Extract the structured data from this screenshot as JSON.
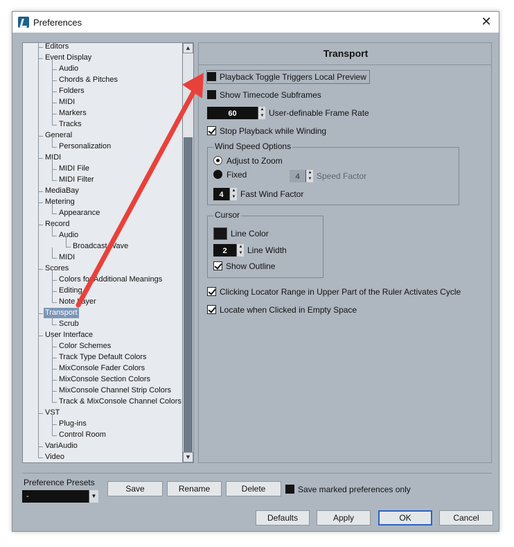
{
  "window": {
    "title": "Preferences",
    "close_glyph": "✕",
    "icon": "cubase-logo-icon"
  },
  "tree": {
    "items": [
      {
        "label": "Editors",
        "depth": 0
      },
      {
        "label": "Event Display",
        "depth": 0
      },
      {
        "label": "Audio",
        "depth": 1
      },
      {
        "label": "Chords & Pitches",
        "depth": 1
      },
      {
        "label": "Folders",
        "depth": 1
      },
      {
        "label": "MIDI",
        "depth": 1
      },
      {
        "label": "Markers",
        "depth": 1
      },
      {
        "label": "Tracks",
        "depth": 1
      },
      {
        "label": "General",
        "depth": 0
      },
      {
        "label": "Personalization",
        "depth": 1
      },
      {
        "label": "MIDI",
        "depth": 0
      },
      {
        "label": "MIDI File",
        "depth": 1
      },
      {
        "label": "MIDI Filter",
        "depth": 1
      },
      {
        "label": "MediaBay",
        "depth": 0
      },
      {
        "label": "Metering",
        "depth": 0
      },
      {
        "label": "Appearance",
        "depth": 1
      },
      {
        "label": "Record",
        "depth": 0
      },
      {
        "label": "Audio",
        "depth": 1
      },
      {
        "label": "Broadcast Wave",
        "depth": 2
      },
      {
        "label": "MIDI",
        "depth": 1
      },
      {
        "label": "Scores",
        "depth": 0
      },
      {
        "label": "Colors for Additional Meanings",
        "depth": 1
      },
      {
        "label": "Editing",
        "depth": 1
      },
      {
        "label": "Note Layer",
        "depth": 1
      },
      {
        "label": "Transport",
        "depth": 0,
        "selected": true
      },
      {
        "label": "Scrub",
        "depth": 1
      },
      {
        "label": "User Interface",
        "depth": 0
      },
      {
        "label": "Color Schemes",
        "depth": 1
      },
      {
        "label": "Track Type Default Colors",
        "depth": 1
      },
      {
        "label": "MixConsole Fader Colors",
        "depth": 1
      },
      {
        "label": "MixConsole Section Colors",
        "depth": 1
      },
      {
        "label": "MixConsole Channel Strip Colors",
        "depth": 1
      },
      {
        "label": "Track & MixConsole Channel Colors",
        "depth": 1
      },
      {
        "label": "VST",
        "depth": 0
      },
      {
        "label": "Plug-ins",
        "depth": 1
      },
      {
        "label": "Control Room",
        "depth": 1
      },
      {
        "label": "VariAudio",
        "depth": 0
      },
      {
        "label": "Video",
        "depth": 0
      }
    ],
    "scroll_up_glyph": "▲",
    "scroll_down_glyph": "▼"
  },
  "transport": {
    "title": "Transport",
    "playback_toggle_local_preview": {
      "label": "Playback Toggle Triggers Local Preview",
      "checked": false
    },
    "show_timecode_subframes": {
      "label": "Show Timecode Subframes",
      "checked": false
    },
    "frame_rate": {
      "value": "60",
      "label": "User-definable Frame Rate"
    },
    "stop_playback_winding": {
      "label": "Stop Playback while Winding",
      "checked": true
    },
    "wind_speed": {
      "group_label": "Wind Speed Options",
      "adjust_to_zoom": {
        "label": "Adjust to Zoom",
        "selected": true
      },
      "fixed": {
        "label": "Fixed",
        "selected": false
      },
      "speed_factor": {
        "value": "4",
        "label": "Speed Factor",
        "enabled": false
      },
      "fast_wind_factor": {
        "value": "4",
        "label": "Fast Wind Factor"
      }
    },
    "cursor": {
      "group_label": "Cursor",
      "line_color_label": "Line Color",
      "line_color": "#161616",
      "line_width": {
        "value": "2",
        "label": "Line Width"
      },
      "show_outline": {
        "label": "Show Outline",
        "checked": true
      }
    },
    "locator_range_cycle": {
      "label": "Clicking Locator Range in Upper Part of the Ruler Activates Cycle",
      "checked": true
    },
    "locate_empty_space": {
      "label": "Locate when Clicked in Empty Space",
      "checked": true
    }
  },
  "presets": {
    "label": "Preference Presets",
    "selected": "-",
    "save_label": "Save",
    "rename_label": "Rename",
    "delete_label": "Delete",
    "save_marked_only": {
      "label": "Save marked preferences only",
      "checked": false
    }
  },
  "footer": {
    "defaults_label": "Defaults",
    "apply_label": "Apply",
    "ok_label": "OK",
    "cancel_label": "Cancel"
  },
  "colors": {
    "dialog_bg": "#aeb7c0",
    "tree_bg": "#e7eaee",
    "selection": "#7c96b6",
    "annotation_arrow": "#e8413a"
  },
  "annotation": {
    "type": "arrow",
    "from": "Transport tree item",
    "to": "Playback Toggle Triggers Local Preview checkbox"
  }
}
